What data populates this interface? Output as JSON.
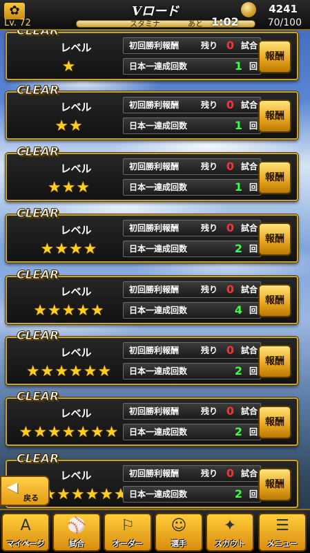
{
  "header": {
    "logo_glyph": "✿",
    "title": "Vロード",
    "coins": "4241",
    "level": "Lv. 72",
    "stamina_label": "スタミナ",
    "time_prefix": "あと",
    "time": "1:02",
    "stamina_value": "70/100"
  },
  "cards": [
    {
      "clear": "CLEAR",
      "level_label": "レベル",
      "stars": "★",
      "reward_label": "初回勝利報酬",
      "remain_label": "残り",
      "remain": "0",
      "remain_unit": "試合",
      "japan_label": "日本一達成回数",
      "japan": "1",
      "japan_unit": "回",
      "button": "報酬"
    },
    {
      "clear": "CLEAR",
      "level_label": "レベル",
      "stars": "★★",
      "reward_label": "初回勝利報酬",
      "remain_label": "残り",
      "remain": "0",
      "remain_unit": "試合",
      "japan_label": "日本一達成回数",
      "japan": "1",
      "japan_unit": "回",
      "button": "報酬"
    },
    {
      "clear": "CLEAR",
      "level_label": "レベル",
      "stars": "★★★",
      "reward_label": "初回勝利報酬",
      "remain_label": "残り",
      "remain": "0",
      "remain_unit": "試合",
      "japan_label": "日本一達成回数",
      "japan": "1",
      "japan_unit": "回",
      "button": "報酬"
    },
    {
      "clear": "CLEAR",
      "level_label": "レベル",
      "stars": "★★★★",
      "reward_label": "初回勝利報酬",
      "remain_label": "残り",
      "remain": "0",
      "remain_unit": "試合",
      "japan_label": "日本一達成回数",
      "japan": "2",
      "japan_unit": "回",
      "button": "報酬"
    },
    {
      "clear": "CLEAR",
      "level_label": "レベル",
      "stars": "★★★★★",
      "reward_label": "初回勝利報酬",
      "remain_label": "残り",
      "remain": "0",
      "remain_unit": "試合",
      "japan_label": "日本一達成回数",
      "japan": "4",
      "japan_unit": "回",
      "button": "報酬"
    },
    {
      "clear": "CLEAR",
      "level_label": "レベル",
      "stars": "★★★★★★",
      "reward_label": "初回勝利報酬",
      "remain_label": "残り",
      "remain": "0",
      "remain_unit": "試合",
      "japan_label": "日本一達成回数",
      "japan": "2",
      "japan_unit": "回",
      "button": "報酬"
    },
    {
      "clear": "CLEAR",
      "level_label": "レベル",
      "stars": "★★★★★★★",
      "reward_label": "初回勝利報酬",
      "remain_label": "残り",
      "remain": "0",
      "remain_unit": "試合",
      "japan_label": "日本一達成回数",
      "japan": "2",
      "japan_unit": "回",
      "button": "報酬"
    },
    {
      "clear": "CLEAR",
      "level_label": "レベル",
      "stars": "★★★★★★★★",
      "reward_label": "初回勝利報酬",
      "remain_label": "残り",
      "remain": "0",
      "remain_unit": "試合",
      "japan_label": "日本一達成回数",
      "japan": "2",
      "japan_unit": "回",
      "button": "報酬"
    }
  ],
  "back": {
    "arrow": "◀",
    "label": "戻る"
  },
  "nav": [
    {
      "icon": "A",
      "icon_name": "home-icon",
      "label": "マイページ"
    },
    {
      "icon": "⚾",
      "icon_name": "stadium-icon",
      "label": "試合"
    },
    {
      "icon": "⚐",
      "icon_name": "order-icon",
      "label": "オーダー"
    },
    {
      "icon": "☺",
      "icon_name": "player-icon",
      "label": "選手"
    },
    {
      "icon": "✦",
      "icon_name": "scout-icon",
      "label": "スカウト"
    },
    {
      "icon": "☰",
      "icon_name": "menu-icon",
      "label": "メニュー"
    }
  ],
  "colors": {
    "gold": "#c8a432",
    "remain_red": "#ff3030",
    "count_green": "#3cff4a",
    "star": "#ffce1e"
  }
}
